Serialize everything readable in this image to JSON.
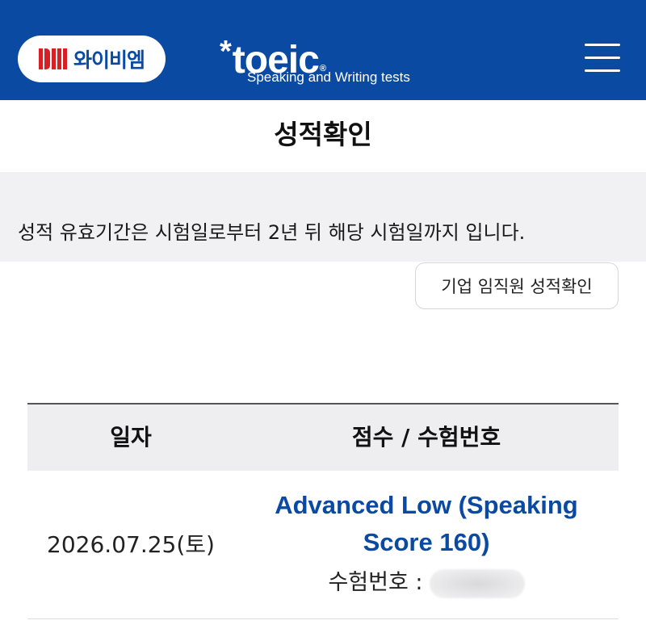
{
  "header": {
    "brand_text": "와이비엠",
    "logo_word": "toeic",
    "logo_star": "*",
    "logo_reg": "®",
    "logo_subtitle": "Speaking and Writing tests"
  },
  "page": {
    "title": "성적확인",
    "notice": "성적 유효기간은 시험일로부터 2년 뒤 해당 시험일까지 입니다.",
    "corp_button": "기업 임직원 성적확인"
  },
  "table": {
    "headers": {
      "date": "일자",
      "score": "점수 / 수험번호"
    },
    "rows": [
      {
        "date": "2026.07.25(토)",
        "score": "Advanced Low (Speaking Score 160)",
        "exam_label": "수험번호 :"
      }
    ]
  },
  "colors": {
    "brand_blue": "#0b4aa2",
    "ybm_red": "#d71f26",
    "notice_bg": "#f1f1f3"
  }
}
